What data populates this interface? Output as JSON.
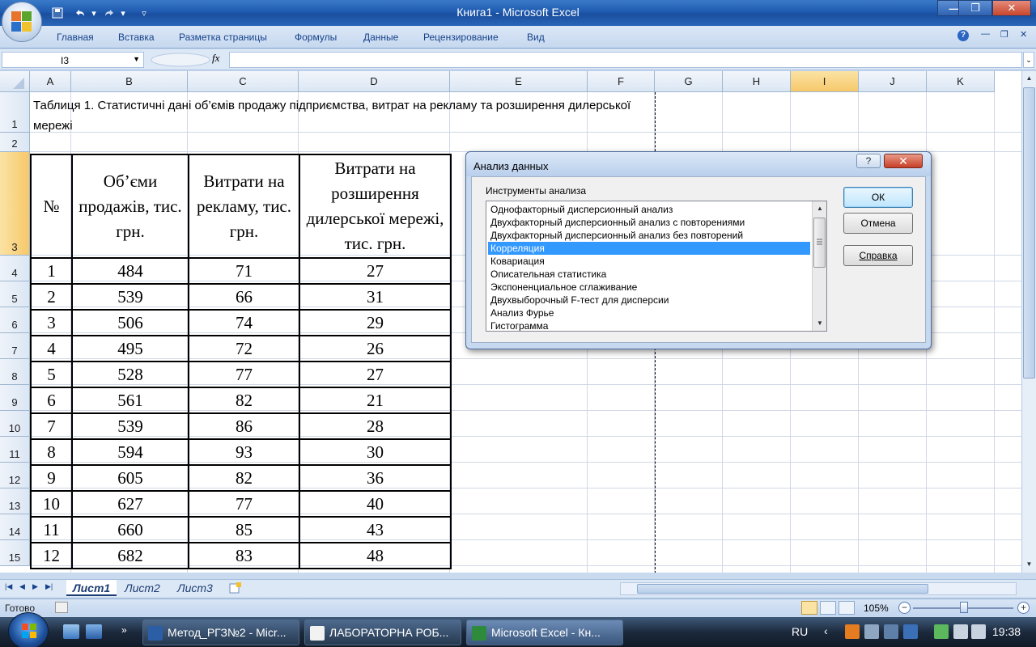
{
  "window": {
    "title": "Книга1 - Microsoft Excel"
  },
  "ribbon": {
    "tabs": [
      "Главная",
      "Вставка",
      "Разметка страницы",
      "Формулы",
      "Данные",
      "Рецензирование",
      "Вид"
    ]
  },
  "formula_bar": {
    "name_box": "I3",
    "fx_label": "fx",
    "value": ""
  },
  "columns": [
    "A",
    "B",
    "C",
    "D",
    "E",
    "F",
    "G",
    "H",
    "I",
    "J",
    "K"
  ],
  "selected_column": "I",
  "rows": [
    "1",
    "2",
    "3",
    "4",
    "5",
    "6",
    "7",
    "8",
    "9",
    "10",
    "11",
    "12",
    "13",
    "14",
    "15"
  ],
  "selected_row": "3",
  "sheet": {
    "title": "Таблиця 1. Статистичні дані об’ємів продажу підприємства, витрат на рекламу та розширення дилерської мережі",
    "table": {
      "headers": [
        "№",
        "Об’єми продажів, тис. грн.",
        "Витрати на рекламу, тис. грн.",
        "Витрати на розширення дилерської мережі, тис. грн."
      ],
      "rows": [
        [
          "1",
          "484",
          "71",
          "27"
        ],
        [
          "2",
          "539",
          "66",
          "31"
        ],
        [
          "3",
          "506",
          "74",
          "29"
        ],
        [
          "4",
          "495",
          "72",
          "26"
        ],
        [
          "5",
          "528",
          "77",
          "27"
        ],
        [
          "6",
          "561",
          "82",
          "21"
        ],
        [
          "7",
          "539",
          "86",
          "28"
        ],
        [
          "8",
          "594",
          "93",
          "30"
        ],
        [
          "9",
          "605",
          "82",
          "36"
        ],
        [
          "10",
          "627",
          "77",
          "40"
        ],
        [
          "11",
          "660",
          "85",
          "43"
        ],
        [
          "12",
          "682",
          "83",
          "48"
        ]
      ]
    }
  },
  "sheet_tabs": [
    "Лист1",
    "Лист2",
    "Лист3"
  ],
  "active_sheet": "Лист1",
  "status": {
    "ready": "Готово",
    "zoom": "105%",
    "zoom_minus": "−",
    "zoom_plus": "+"
  },
  "dialog": {
    "title": "Анализ данных",
    "help": "?",
    "close": "✕",
    "tools_label": "Инструменты анализа",
    "tools": [
      "Однофакторный дисперсионный анализ",
      "Двухфакторный дисперсионный анализ с повторениями",
      "Двухфакторный дисперсионный анализ без повторений",
      "Корреляция",
      "Ковариация",
      "Описательная статистика",
      "Экспоненциальное сглаживание",
      "Двухвыборочный F-тест для дисперсии",
      "Анализ Фурье",
      "Гистограмма"
    ],
    "selected_tool": "Корреляция",
    "ok": "ОК",
    "cancel": "Отмена",
    "help_button": "Справка"
  },
  "taskbar": {
    "tasks": [
      "Метод_РГЗ№2 - Micr...",
      "ЛАБОРАТОРНА РОБ...",
      "Microsoft Excel - Кн..."
    ],
    "language": "RU",
    "time": "19:38"
  },
  "colors": {
    "title_bar": "#1f5bb0",
    "selection": "#3399ff",
    "header_selected": "#f6c86a"
  }
}
